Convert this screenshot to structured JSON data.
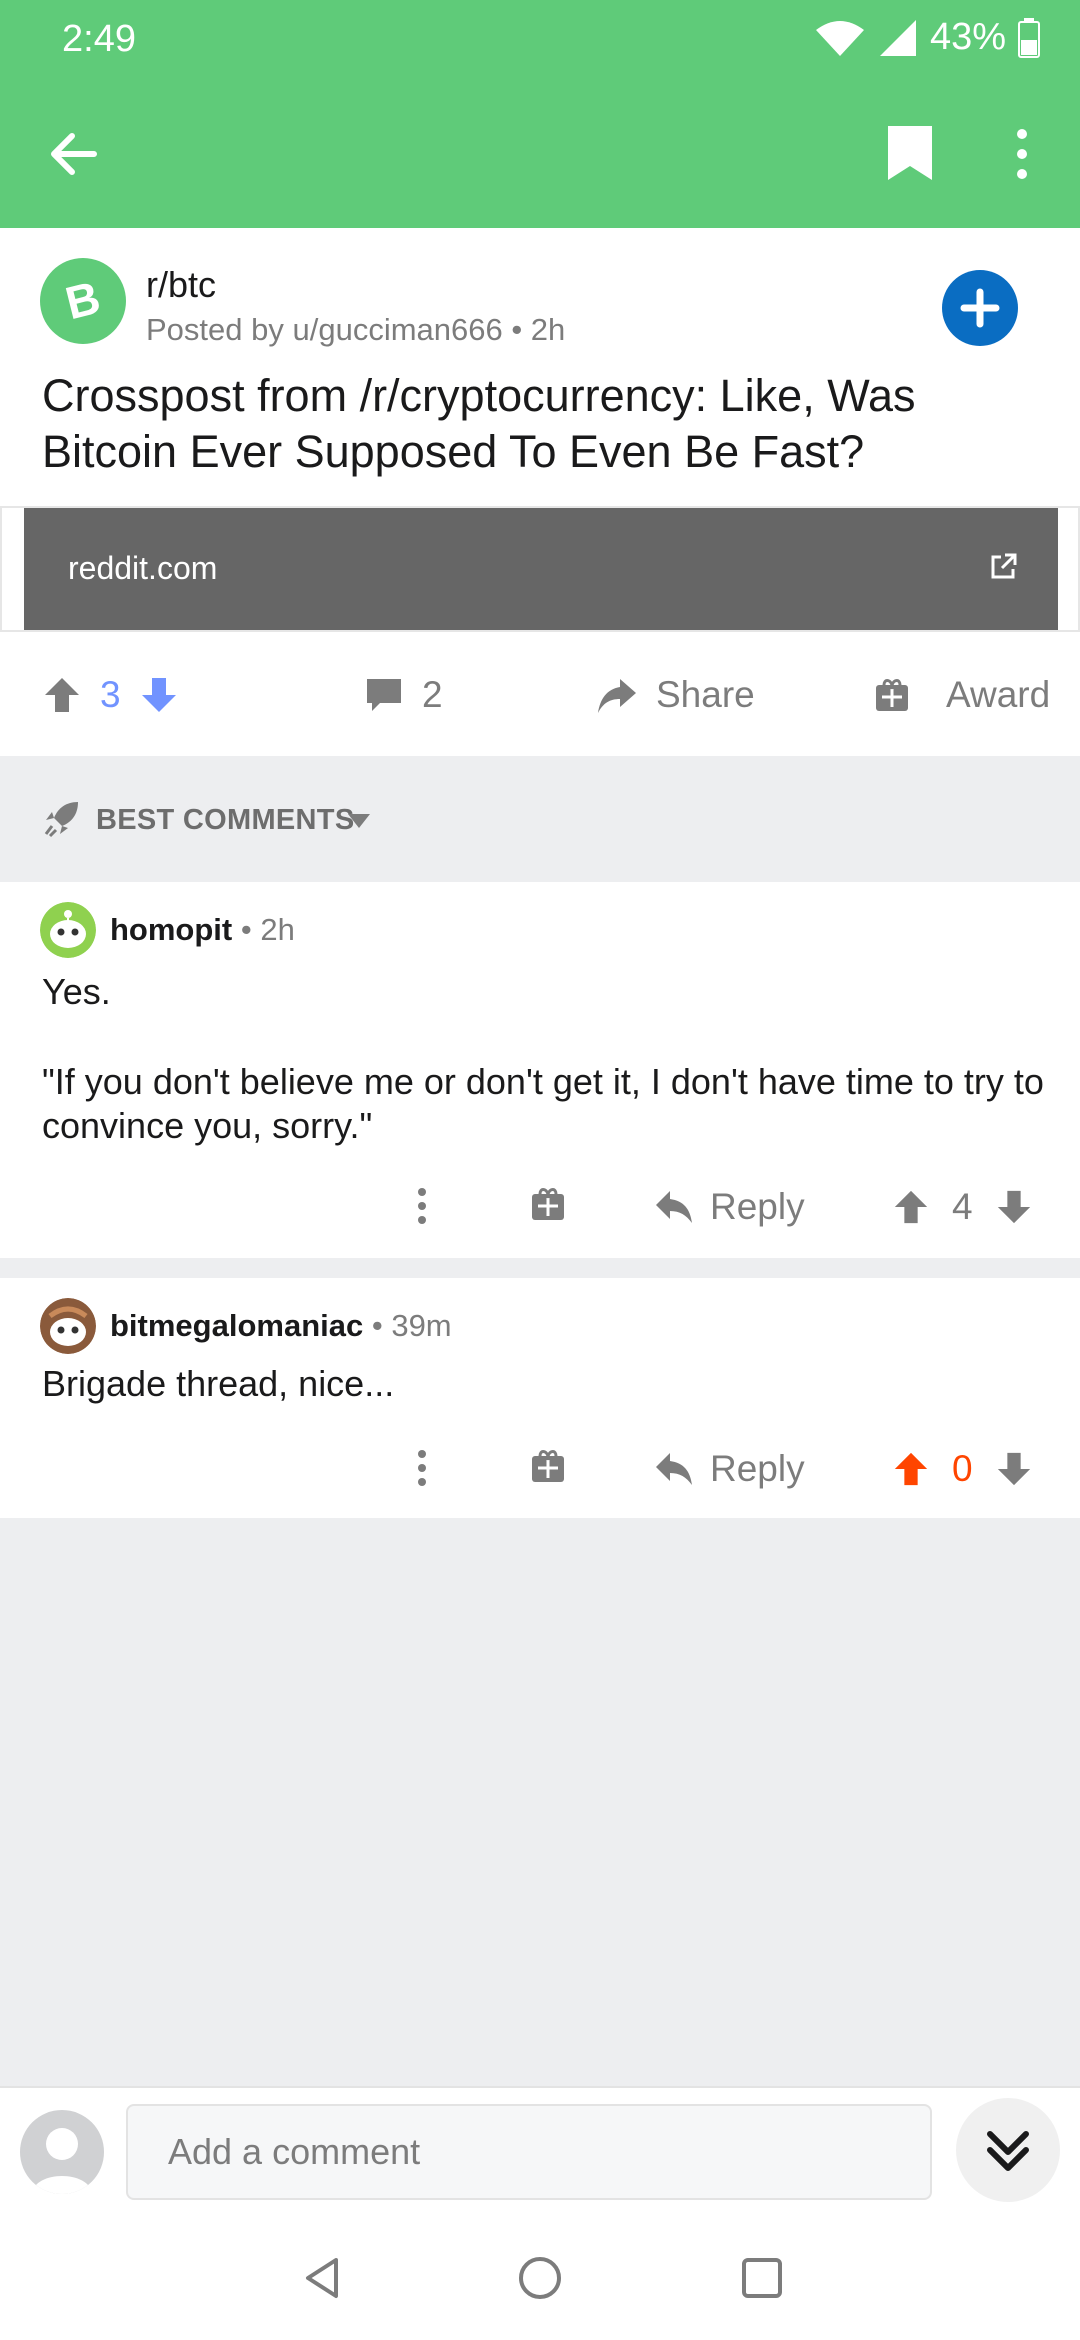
{
  "status_bar": {
    "time": "2:49",
    "battery": "43%"
  },
  "app_bar": {
    "back_icon": "arrow-left-icon",
    "bookmark_icon": "bookmark-icon",
    "more_icon": "more-vertical-icon"
  },
  "post": {
    "subreddit": "r/btc",
    "posted_by": "Posted by u/gucciman666 • 2h",
    "title": "Crosspost from /r/cryptocurrency: Like, Was Bitcoin Ever Supposed To Even Be Fast?",
    "link_domain": "reddit.com",
    "score": "3",
    "comment_count": "2",
    "share_label": "Share",
    "award_label": "Award"
  },
  "sort": {
    "label": "BEST COMMENTS"
  },
  "comments": [
    {
      "user": "homopit",
      "time": " • 2h",
      "body_line1": "Yes.",
      "body_line2": "\"If you don't believe me or don't get it, I don't have time to try to convince you, sorry.\"",
      "reply_label": "Reply",
      "score": "4"
    },
    {
      "user": "bitmegalomaniac",
      "time": " • 39m",
      "body_line1": "Brigade thread, nice...",
      "reply_label": "Reply",
      "score": "0"
    }
  ],
  "composer": {
    "placeholder": "Add a comment"
  },
  "colors": {
    "brand_green": "#5fcb79",
    "upvote_blue": "#7193ff",
    "upvote_orange": "#ff4500",
    "join_blue": "#0a6dc2"
  }
}
